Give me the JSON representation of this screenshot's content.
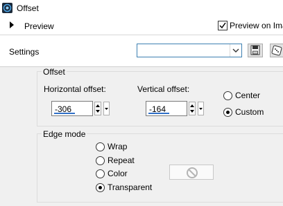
{
  "window": {
    "title": "Offset"
  },
  "preview": {
    "label": "Preview",
    "checkbox_label": "Preview on Image",
    "checked": true
  },
  "settings": {
    "label": "Settings",
    "preset_value": ""
  },
  "offset": {
    "group_title": "Offset",
    "horizontal": {
      "label": "Horizontal offset:",
      "value": "-306"
    },
    "vertical": {
      "label": "Vertical offset:",
      "value": "-164"
    },
    "center_label": "Center",
    "custom_label": "Custom",
    "selected": "Custom"
  },
  "edge_mode": {
    "group_title": "Edge mode",
    "options": [
      "Wrap",
      "Repeat",
      "Color",
      "Transparent"
    ],
    "selected": "Transparent"
  },
  "colors": {
    "accent": "#3070c8",
    "panel": "#f0f0f0",
    "white": "#ffffff"
  }
}
